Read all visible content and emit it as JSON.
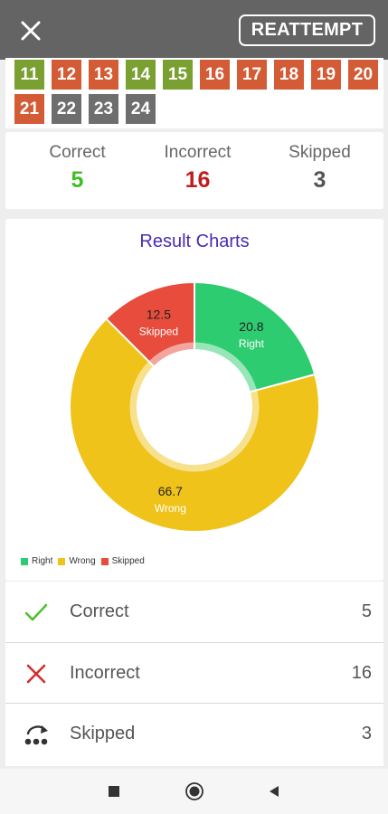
{
  "header": {
    "close_icon": "close-icon",
    "reattempt_label": "REATTEMPT"
  },
  "colors": {
    "correct": "#7aa031",
    "incorrect": "#d35b35",
    "skipped": "#6e6e6e",
    "right_slice": "#2ecc71",
    "wrong_slice": "#efc31a",
    "skipped_slice": "#e74c3c",
    "title": "#4a2bb0"
  },
  "questions": {
    "row1": [
      {
        "num": "11",
        "status": "correct"
      },
      {
        "num": "12",
        "status": "incorrect"
      },
      {
        "num": "13",
        "status": "incorrect"
      },
      {
        "num": "14",
        "status": "correct"
      },
      {
        "num": "15",
        "status": "correct"
      },
      {
        "num": "16",
        "status": "incorrect"
      },
      {
        "num": "17",
        "status": "incorrect"
      },
      {
        "num": "18",
        "status": "incorrect"
      },
      {
        "num": "19",
        "status": "incorrect"
      },
      {
        "num": "20",
        "status": "incorrect"
      }
    ],
    "row2": [
      {
        "num": "21",
        "status": "incorrect"
      },
      {
        "num": "22",
        "status": "skipped"
      },
      {
        "num": "23",
        "status": "skipped"
      },
      {
        "num": "24",
        "status": "skipped"
      }
    ]
  },
  "summary": {
    "correct_label": "Correct",
    "correct_value": "5",
    "incorrect_label": "Incorrect",
    "incorrect_value": "16",
    "skipped_label": "Skipped",
    "skipped_value": "3"
  },
  "chart_data": {
    "type": "pie",
    "title": "Result Charts",
    "slices": [
      {
        "label": "Right",
        "value": 20.8,
        "value_label": "20.8",
        "color": "#2ecc71"
      },
      {
        "label": "Wrong",
        "value": 66.7,
        "value_label": "66.7",
        "color": "#efc31a"
      },
      {
        "label": "Skipped",
        "value": 12.5,
        "value_label": "12.5",
        "color": "#e74c3c"
      }
    ],
    "legend": [
      "Right",
      "Wrong",
      "Skipped"
    ],
    "legend_position": "bottom-left",
    "donut": true
  },
  "list": [
    {
      "label": "Correct",
      "value": "5",
      "icon": "checkmark-icon"
    },
    {
      "label": "Incorrect",
      "value": "16",
      "icon": "cross-icon"
    },
    {
      "label": "Skipped",
      "value": "3",
      "icon": "skip-icon"
    }
  ],
  "navbar": {
    "icons": [
      "recent-apps-icon",
      "home-icon",
      "back-icon"
    ]
  }
}
